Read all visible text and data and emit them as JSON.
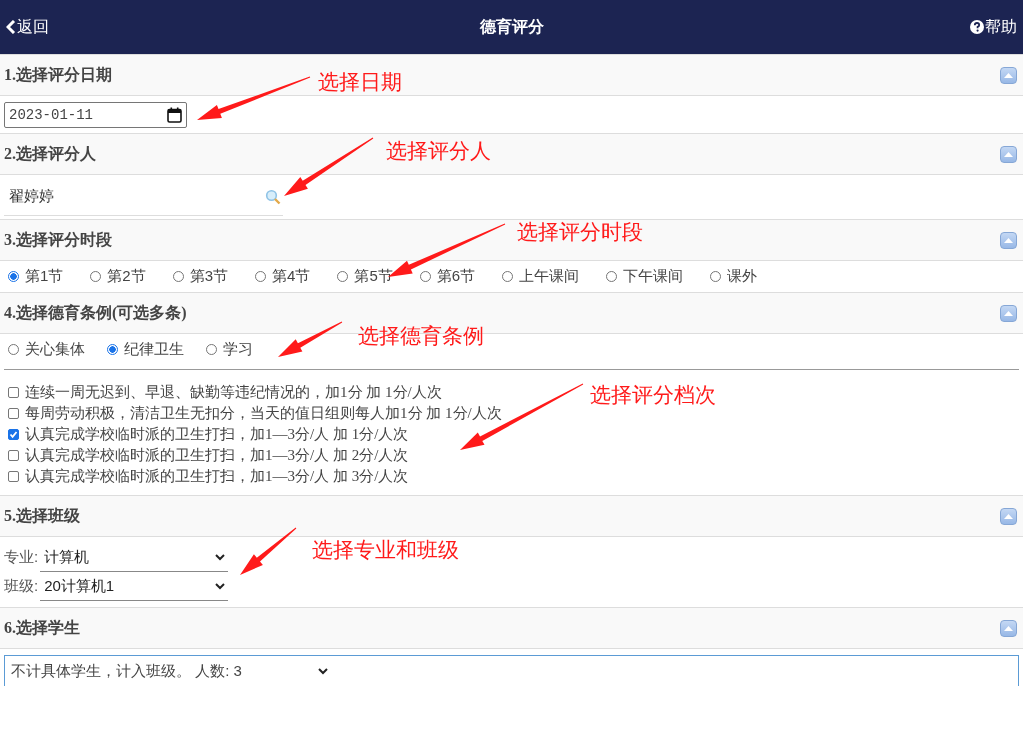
{
  "header": {
    "back": "返回",
    "title": "德育评分",
    "help": "帮助"
  },
  "date_section": {
    "title": "1.选择评分日期",
    "date": "2023-01-11"
  },
  "rater_section": {
    "title": "2.选择评分人",
    "value": "翟婷婷"
  },
  "period_section": {
    "title": "3.选择评分时段",
    "options": [
      {
        "label": "第1节",
        "selected": true
      },
      {
        "label": "第2节",
        "selected": false
      },
      {
        "label": "第3节",
        "selected": false
      },
      {
        "label": "第4节",
        "selected": false
      },
      {
        "label": "第5节",
        "selected": false
      },
      {
        "label": "第6节",
        "selected": false
      },
      {
        "label": "上午课间",
        "selected": false
      },
      {
        "label": "下午课间",
        "selected": false
      },
      {
        "label": "课外",
        "selected": false
      }
    ]
  },
  "rules_section": {
    "title": "4.选择德育条例(可选多条)",
    "categories": [
      {
        "label": "关心集体",
        "selected": false
      },
      {
        "label": "纪律卫生",
        "selected": true
      },
      {
        "label": "学习",
        "selected": false
      }
    ],
    "rules": [
      {
        "label": "连续一周无迟到、早退、缺勤等违纪情况的，加1分 加 1分/人次",
        "checked": false
      },
      {
        "label": "每周劳动积极，清洁卫生无扣分，当天的值日组则每人加1分 加 1分/人次",
        "checked": false
      },
      {
        "label": "认真完成学校临时派的卫生打扫，加1—3分/人 加 1分/人次",
        "checked": true
      },
      {
        "label": "认真完成学校临时派的卫生打扫，加1—3分/人 加 2分/人次",
        "checked": false
      },
      {
        "label": "认真完成学校临时派的卫生打扫，加1—3分/人 加 3分/人次",
        "checked": false
      }
    ]
  },
  "class_section": {
    "title": "5.选择班级",
    "fields": [
      {
        "label": "专业:",
        "value": "计算机"
      },
      {
        "label": "班级:",
        "value": "20计算机1"
      }
    ]
  },
  "student_section": {
    "title": "6.选择学生",
    "value": "不计具体学生，计入班级。 人数: 3"
  },
  "annotations": [
    {
      "text": "选择日期"
    },
    {
      "text": "选择评分人"
    },
    {
      "text": "选择评分时段"
    },
    {
      "text": "选择德育条例"
    },
    {
      "text": "选择评分档次"
    },
    {
      "text": "选择专业和班级"
    }
  ]
}
